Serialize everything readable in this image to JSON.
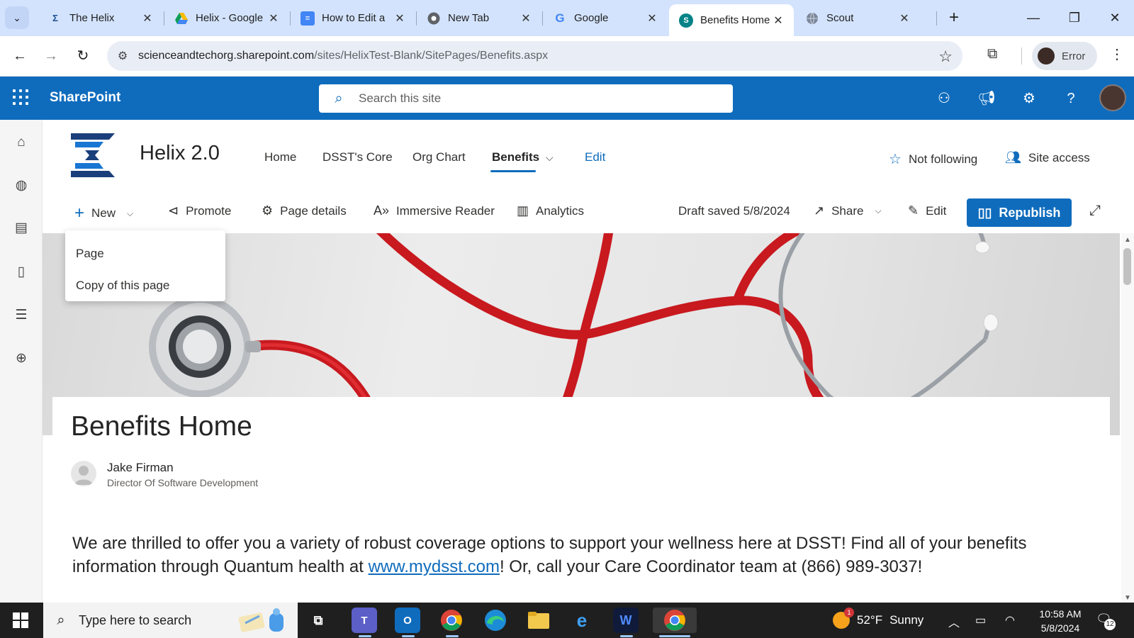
{
  "browser": {
    "tabs": [
      {
        "title": "The Helix",
        "icon": "helix-icon"
      },
      {
        "title": "Helix - Google",
        "icon": "google-drive-icon"
      },
      {
        "title": "How to Edit a",
        "icon": "google-docs-icon"
      },
      {
        "title": "New Tab",
        "icon": "chrome-icon"
      },
      {
        "title": "Google",
        "icon": "google-icon"
      },
      {
        "title": "Benefits Home",
        "icon": "sharepoint-icon"
      },
      {
        "title": "Scout",
        "icon": "globe-icon"
      }
    ],
    "url_domain": "scienceandtechorg.sharepoint.com",
    "url_path": "/sites/HelixTest-Blank/SitePages/Benefits.aspx",
    "profile_label": "Error"
  },
  "suitebar": {
    "brand": "SharePoint",
    "search_placeholder": "Search this site"
  },
  "site": {
    "title": "Helix 2.0",
    "nav": [
      "Home",
      "DSST's Core",
      "Org Chart",
      "Benefits"
    ],
    "edit_label": "Edit",
    "follow_label": "Not following",
    "site_access_label": "Site access"
  },
  "commandbar": {
    "new_label": "New",
    "promote_label": "Promote",
    "page_details_label": "Page details",
    "immersive_reader_label": "Immersive Reader",
    "analytics_label": "Analytics",
    "draft_status": "Draft saved 5/8/2024",
    "share_label": "Share",
    "edit_label": "Edit",
    "republish_label": "Republish"
  },
  "new_menu": {
    "items": [
      "Page",
      "Copy of this page"
    ]
  },
  "page": {
    "title": "Benefits Home",
    "author_name": "Jake Firman",
    "author_role": "Director Of Software Development",
    "body_before_link": "We are thrilled to offer you a variety of robust coverage options to support your wellness here at DSST! Find all of your benefits information through Quantum health at ",
    "link_text": "www.mydsst.com",
    "body_after_link": "! Or, call your Care Coordinator team at (866) 989-3037!"
  },
  "taskbar": {
    "search_placeholder": "Type here to search",
    "weather_temp": "52°F",
    "weather_desc": "Sunny",
    "weather_badge": "1",
    "time": "10:58 AM",
    "date": "5/8/2024",
    "notification_count": "12"
  },
  "colors": {
    "sharepoint_blue": "#0f6cbd",
    "tabstrip": "#d3e3fd",
    "taskbar": "#1f1f1f"
  }
}
